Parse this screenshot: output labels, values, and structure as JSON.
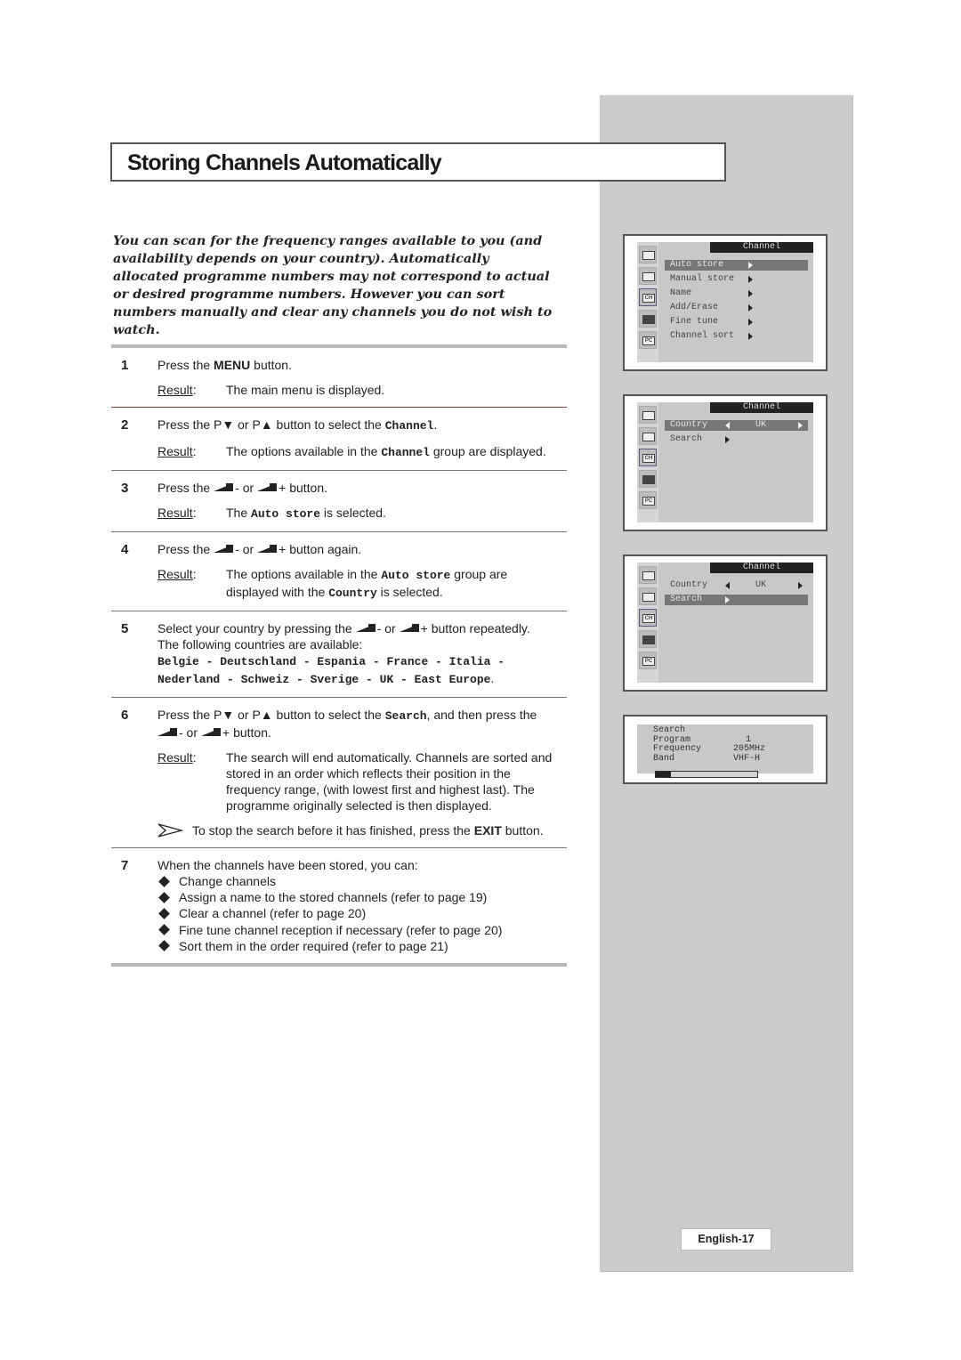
{
  "page": {
    "title": "Storing Channels Automatically",
    "intro": "You can scan for the frequency ranges available to you (and availability depends on your country). Automatically allocated programme numbers may not correspond to actual or desired programme numbers. However you can sort numbers manually and clear any channels you do not wish to watch.",
    "page_number": "English-17"
  },
  "steps": {
    "result_label": "Result",
    "s1": {
      "num": "1",
      "pre": "Press the ",
      "key": "MENU",
      "post": " button.",
      "result": "The main menu is displayed."
    },
    "s2": {
      "num": "2",
      "pre": "Press the P▼ or P▲ button to select the ",
      "code": "Channel",
      "post": ".",
      "result_pre": "The options available in the ",
      "result_code": "Channel",
      "result_post": " group are displayed."
    },
    "s3": {
      "num": "3",
      "pre": "Press the",
      "mid": "- or",
      "post": "+ button.",
      "result_pre": "The ",
      "result_code": "Auto store",
      "result_post": " is selected."
    },
    "s4": {
      "num": "4",
      "pre": "Press the",
      "mid": "- or",
      "post": "+ button again.",
      "result_pre": "The options available in the ",
      "result_code": "Auto store",
      "result_mid": " group are displayed with the ",
      "result_code2": "Country",
      "result_post": " is selected."
    },
    "s5": {
      "num": "5",
      "pre": "Select your country by pressing the",
      "mid": "- or",
      "post": "+ button repeatedly.",
      "line2": "The following countries are available:",
      "countries": "Belgie - Deutschland - Espania - France - Italia - Nederland - Schweiz - Sverige - UK - East Europe",
      "countries_end": "."
    },
    "s6": {
      "num": "6",
      "pre": "Press the P▼ or P▲ button to select the ",
      "code": "Search",
      "post": ", and then press the",
      "line2_mid": "- or",
      "line2_post": "+ button.",
      "result": "The search will end automatically. Channels are sorted and stored in an order which reflects their position in the frequency range, (with lowest first and highest last). The programme originally selected is then displayed.",
      "note_pre": "To stop the search before it has finished, press the ",
      "note_key": "EXIT",
      "note_post": " button."
    },
    "s7": {
      "num": "7",
      "intro": "When the channels have been stored, you can:",
      "bullets": [
        "Change channels",
        "Assign a name to the stored channels (refer to page 19)",
        "Clear a channel (refer to page 20)",
        "Fine tune channel reception if necessary (refer to page 20)",
        "Sort them in the order required (refer to page 21)"
      ]
    }
  },
  "osd": {
    "header": "Channel",
    "side_icons": [
      "picture-icon",
      "sound-icon",
      "channel-icon",
      "setup-icon",
      "pc-icon"
    ],
    "side_icon_labels": [
      "",
      "",
      "CH",
      "",
      "PC"
    ],
    "screen1": {
      "items": [
        "Auto store",
        "Manual store",
        "Name",
        "Add/Erase",
        "Fine tune",
        "Channel sort"
      ],
      "selected": "Auto store"
    },
    "screen2": {
      "country_label": "Country",
      "country_value": "UK",
      "search_label": "Search",
      "selected": "Country"
    },
    "screen3": {
      "country_label": "Country",
      "country_value": "UK",
      "search_label": "Search",
      "selected": "Search"
    },
    "screen4": {
      "title": "Search",
      "program_label": "Program",
      "program_value": "1",
      "frequency_label": "Frequency",
      "frequency_value": "205MHz",
      "band_label": "Band",
      "band_value": "VHF-H",
      "progress_percent": 15
    }
  }
}
